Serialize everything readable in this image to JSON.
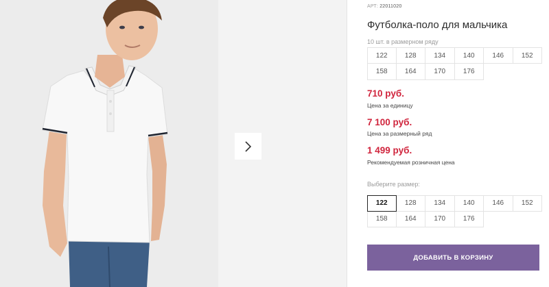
{
  "product": {
    "sku_label": "АРТ:",
    "sku_value": "22011020",
    "title": "Футболка-поло для мальчика",
    "set_note": "10 шт. в размерном ряду"
  },
  "set_sizes": [
    "122",
    "128",
    "134",
    "140",
    "146",
    "152",
    "158",
    "164",
    "170",
    "176"
  ],
  "prices": {
    "unit_price": "710 руб.",
    "unit_label": "Цена за единицу",
    "set_price": "7 100 руб.",
    "set_label": "Цена за размерный ряд",
    "retail_price": "1 499 руб.",
    "retail_label": "Рекомендуемая розничная цена"
  },
  "size_picker": {
    "label": "Выберите размер:",
    "options": [
      "122",
      "128",
      "134",
      "140",
      "146",
      "152",
      "158",
      "164",
      "170",
      "176"
    ],
    "selected": "122"
  },
  "actions": {
    "add_to_cart": "ДОБАВИТЬ В КОРЗИНУ"
  },
  "gallery": {
    "next_icon": "chevron-right-icon"
  },
  "colors": {
    "price_red": "#d0253d",
    "button_purple": "#7b629d",
    "photo_bg": "#ededed"
  }
}
